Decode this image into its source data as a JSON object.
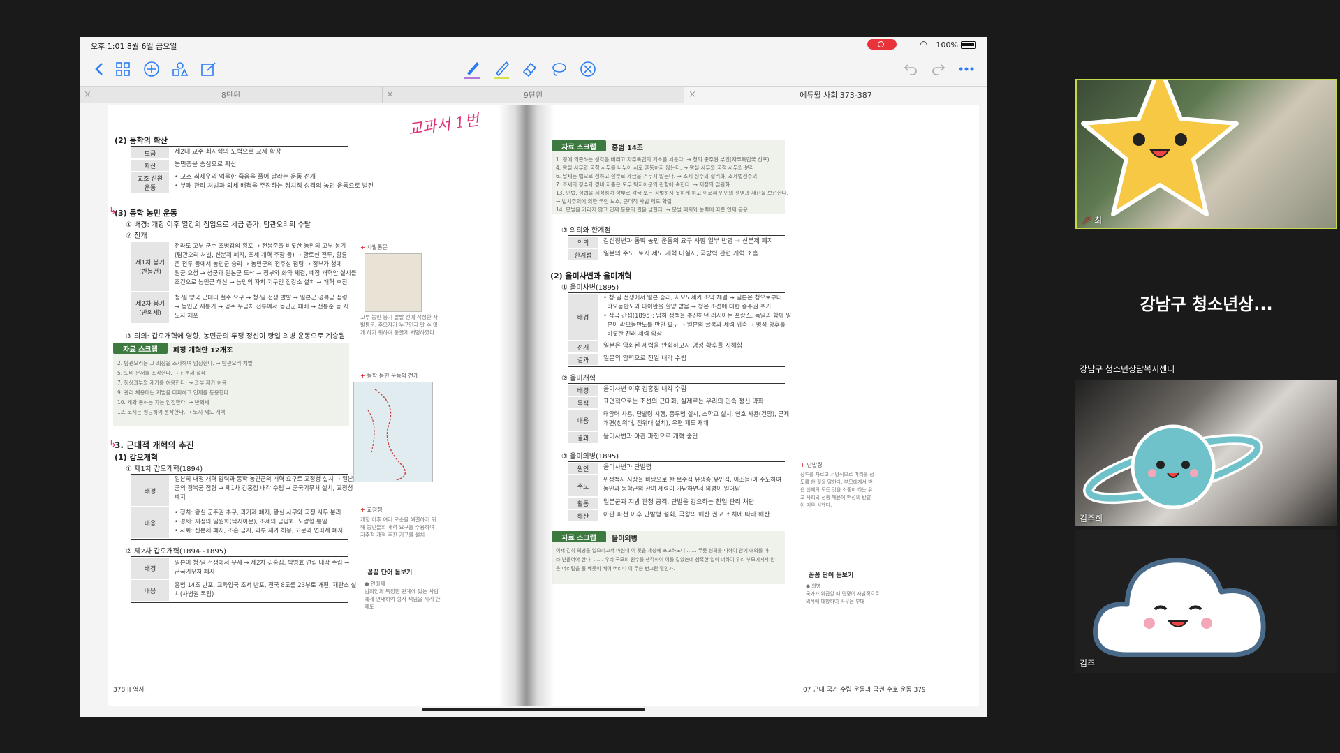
{
  "statusbar": {
    "time": "오후 1:01  8월 6일 금요일",
    "battery": "100%"
  },
  "tabs": [
    {
      "label": "8단원"
    },
    {
      "label": "9단원"
    },
    {
      "label": "에듀윌 사회 373-387"
    }
  ],
  "left_page": {
    "scribble": "교과서 1번",
    "sec_2": "(2) 동학의 확산",
    "spread_rows": [
      {
        "label": "보급",
        "text": "제2대 교주 최시형의 노력으로 교세 확장"
      },
      {
        "label": "확산",
        "text": "농민층을 중심으로 확산"
      },
      {
        "label": "교조 신원\n운동",
        "text": "• 교조 최제우의 억울한 죽음을 풀어 달라는 운동 전개\n• 부패 관리 처벌과 외세 배척을 주장하는 정치적 성격의 농민 운동으로 발전"
      }
    ],
    "sec_3": "(3) 동학 농민 운동",
    "bg": "① 배경: 개항 이후 열강의 침입으로 세금 증가, 탐관오리의 수탈",
    "war": "② 전개",
    "war_rows": [
      {
        "label": "제1차 봉기\n(반봉건)",
        "text": "전라도 고부 군수 조병갑의 횡포 → 전봉준을 비롯한 농민의 고부 봉기\n(탐관오리 처벌, 신분제 폐지, 조세 개혁 주장 등) → 황토현 전투, 황룡\n촌 전투 등에서 농민군 승리 → 농민군의 전주성 점령 → 정부가 청에\n원군 요청 → 청군과 일본군 도착 → 정부와 화약 체결, 폐정 개혁안 실시를\n조건으로 농민군 해산 → 농민의 자치 기구인 집강소 설치 → 개혁 추진"
      },
      {
        "label": "제2차 봉기\n(반외세)",
        "text": "청·일 양국 군대의 철수 요구 → 청·일 전쟁 발발 → 일본군 경복궁 점령\n→ 농민군 재봉기 → 공주 우금치 전투에서 농민군 패배 → 전봉준 등 지\n도자 체포"
      }
    ],
    "meaning": "③ 의의: 갑오개혁에 영향, 농민군의 투쟁 정신이 항일 의병 운동으로 계승됨",
    "material_tag": "자료 스크랩",
    "material_title": "폐정 개혁안 12개조",
    "material_lines": [
      "2. 탐관오리는 그 죄상을 조사하여 엄징한다. → 탐관오리 처벌",
      "5. 노비 문서를 소각한다. → 신분제 철폐",
      "7. 청상과부의 개가를 허용한다. → 과부 재가 허용",
      "9. 관리 채용에는 지벌을 타파하고 인재를 등용한다.",
      "10. 왜와 통하는 자는 엄징한다. → 반외세",
      "12. 토지는 평균하여 분작한다. → 토지 제도 개혁"
    ],
    "sec_big": "3. 근대적 개혁의 추진",
    "gabo": "(1) 갑오개혁",
    "gabo1": "① 제1차 갑오개혁(1894)",
    "gabo1_rows": [
      {
        "label": "배경",
        "text": "일본의 내정 개혁 압력과 동학 농민군의 개혁 요구로 교정청 설치 → 일본\n군의 경복궁 점령 → 제1차 김홍집 내각 수립 → 군국기무처 설치, 교정청\n폐지"
      },
      {
        "label": "내용",
        "text": "• 정치: 왕실 군주권 추구, 과거제 폐지, 왕실 사무와 국정 사무 분리\n• 경제: 재정의 일원화(탁지아문), 조세의 금납화, 도량형 통일\n• 사회: 신분제 폐지, 조혼 금지, 과부 재가 허용, 고문과 연좌제 폐지"
      }
    ],
    "gabo2": "② 제2차 갑오개혁(1894~1895)",
    "gabo2_rows": [
      {
        "label": "배경",
        "text": "일본이 청·일 전쟁에서 우세 → 제2차 김홍집, 박영효 연립 내각 수립 →\n군국기무처 폐지"
      },
      {
        "label": "내용",
        "text": "홍범 14조 반포, 교육입국 조서 반포, 전국 8도를 23부로 개편, 재판소 설\n치(사법권 독립)"
      }
    ],
    "side_tag1": "사발통문",
    "side_note1": "고부 농민 봉기 발발 전에 작성한 사\n발통문. 주모자가 누구인지 알 수 없\n게 하기 위하여 둥글게 서명하였다.",
    "side_tag2": "동학 농민 운동의 전개",
    "side_tag3": "교정청",
    "side_note3": "개항 이후 여러 모순을 해결하기 위\n해 농민들의 개혁 요구를 수용하여\n자주적 개혁 추진 기구를 설치",
    "side_tag4": "꼼꼼 단어 돋보기",
    "side_note4": "● 연좌제\n범죄인과 특정한 관계에 있는 사람\n에게 연대하여 형사 책임을 지게 한\n제도",
    "footer": "378  II 역사"
  },
  "right_page": {
    "material_tag": "자료 스크랩",
    "material_title": "홍범 14조",
    "material_lines": [
      "1. 청에 의존하는 생각을 버리고 자주독립의 기초를 세운다. → 청의 종주권 부인(자주독립국 선포)",
      "4. 왕실 사무와 국정 사무를 나누어 서로 혼동하지 않는다. → 왕실 사무와 국정 사무의 분리",
      "6. 납세는 법으로 정하고 함부로 세금을 거두지 않는다. → 조세 징수의 합리화, 조세법정주의",
      "7. 조세의 징수와 경비 지출은 모두 탁지아문의 관할에 속한다. → 재정의 일원화",
      "13. 민법, 형법을 제정하여 함부로 감금 또는 징벌하지 못하게 하고 이로써 인민의 생명과 재산을 보전한다.",
      "     → 법치주의에 의한 국민 보호, 근대적 사법 제도 확립",
      "14. 문벌을 가리지 않고 인재 등용의 길을 넓힌다. → 문벌 폐지와 능력에 따른 인재 등용"
    ],
    "meaning": "③ 의의와 한계점",
    "meaning_rows": [
      {
        "label": "의의",
        "text": "갑신정변과 동학 농민 운동의 요구 사항 일부 반영 → 신분제 폐지"
      },
      {
        "label": "한계점",
        "text": "일본의 주도, 토지 제도 개혁 미실시, 국방력 관련 개혁 소홀"
      }
    ],
    "sec_2": "(2) 을미사변과 을미개혁",
    "s1": "① 을미사변(1895)",
    "s1_rows": [
      {
        "label": "배경",
        "text": "• 청·일 전쟁에서 일본 승리, 시모노세키 조약 체결 → 일본은 청으로부터\n  랴오둥반도와 타이완을 할양 받음 → 청은 조선에 대한 종주권 포기\n• 삼국 간섭(1895): 남하 정책을 추진하던 러시아는 프랑스, 독일과 함께 일\n  본이 랴오둥반도를 반환 요구 → 일본의 굴복과 세력 위축 → 명성 황후를\n  비롯한 친러 세력 확장"
      },
      {
        "label": "전개",
        "text": "일본은 약화된 세력을 만회하고자 명성 황후를 시해함"
      },
      {
        "label": "결과",
        "text": "일본의 압력으로 친일 내각 수립"
      }
    ],
    "s2": "② 을미개혁",
    "s2_rows": [
      {
        "label": "배경",
        "text": "을미사변 이후 김홍집 내각 수립"
      },
      {
        "label": "목적",
        "text": "표면적으로는 조선의 근대화, 실제로는 우리의 민족 정신 약화"
      },
      {
        "label": "내용",
        "text": "태양력 사용, 단발령 시행, 종두법 실시, 소학교 설치, 연호 사용(건양), 군제\n개편(친위대, 진위대 설치), 우편 제도 재개"
      },
      {
        "label": "결과",
        "text": "을미사변과 아관 파천으로 개혁 중단"
      }
    ],
    "s3": "③ 을미의병(1895)",
    "s3_rows": [
      {
        "label": "원인",
        "text": "을미사변과 단발령"
      },
      {
        "label": "주도",
        "text": "위정척사 사상을 바탕으로 한 보수적 유생층(유인석, 이소응)이 주도하여\n농민과 동학군의 잔여 세력이 가담하면서 의병이 일어남"
      },
      {
        "label": "활동",
        "text": "일본군과 지방 관청 공격, 단발을 강요하는 친일 관리 처단"
      },
      {
        "label": "해산",
        "text": "아관 파천 이후 단발령 철회, 국왕의 해산 권고 조치에 따라 해산"
      }
    ],
    "material2_tag": "자료 스크랩",
    "material2_title": "을미의병",
    "material2_text": "이제 김히 의병을 일으키고서 마침내 이 뜻을 세상에 포고하노니 …… 무릇 성의를 다하여 함께 대의를 따\n라 받들어야 한다. …… 우리 국모의 원수를 생각하여 이를 갈았는데 참혹한 일이 더하여 우리 부모에게서 받\n은 머리털을 풀 베듯이 베어 버리니 이 무슨 변고란 말인가.",
    "side_tag1": "단발령",
    "side_note1": "상투를 자르고 서양식으로 머리를 정\n도록 한 것을 말한다. 부모에게서 받\n은 신체의 모든 것을 소중히 하는 유\n교 사회의 전통 때문에 백성의 반발\n이 매우 심했다.",
    "side_tag2": "꼼꼼 단어 돋보기",
    "side_note2": "● 의병\n국가가 위급할 때 민중이 자발적으로\n외적에 대항하여 싸우는 부대",
    "footer": "07 근대 국가 수립 운동과 국권 수호 운동  379"
  },
  "participants": [
    {
      "name": "최",
      "muted": true
    },
    {
      "name": "강남구 청소년상...",
      "subname": "강남구 청소년상담복지센터"
    },
    {
      "name": "김주희"
    },
    {
      "name": "김주"
    }
  ],
  "colors": {
    "accent_green": "#3d7a40",
    "highlight": "#c8d84b",
    "rec": "#e8333a",
    "scribble": "#e0307a"
  }
}
